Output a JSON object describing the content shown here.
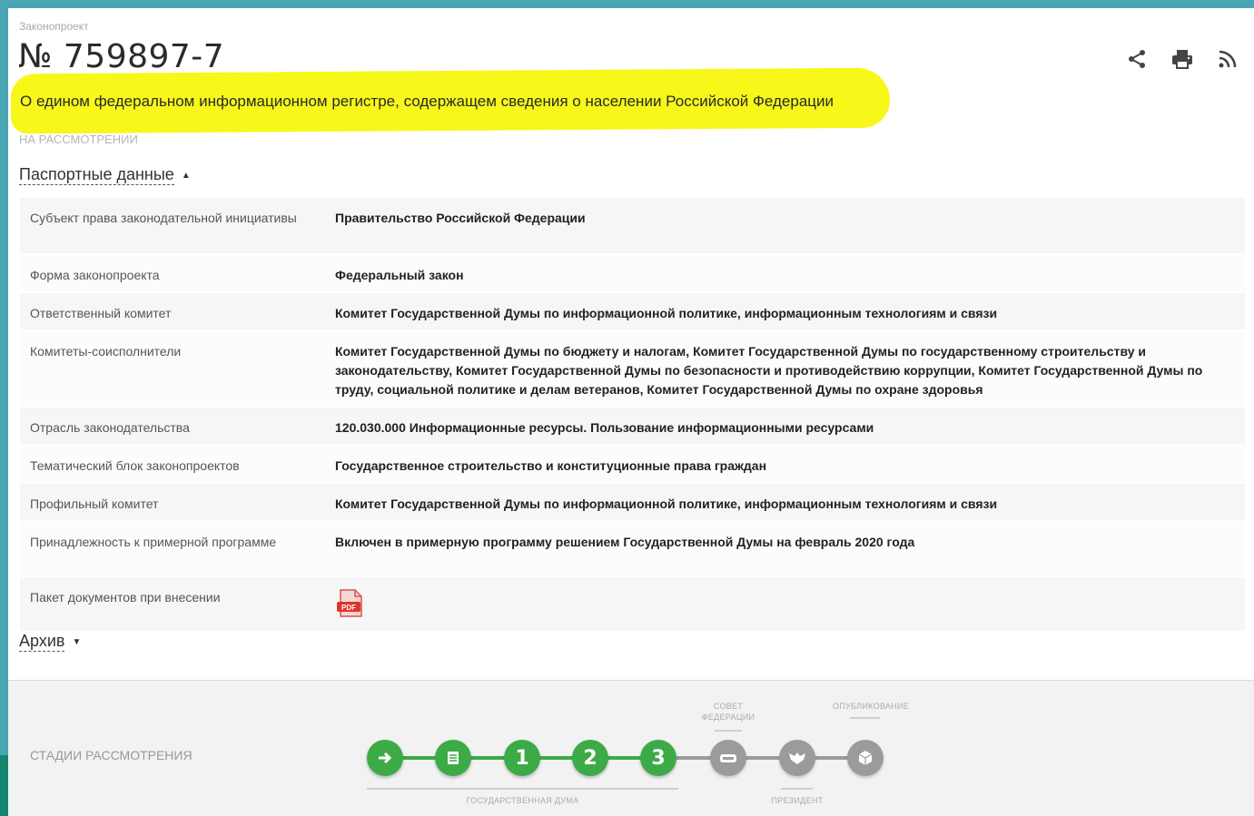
{
  "header": {
    "overline": "Законопроект",
    "number": "№ 759897-7",
    "title": "О едином федеральном информационном регистре, содержащем сведения о населении Российской Федерации",
    "status": "НА РАССМОТРЕНИИ"
  },
  "toolbar": {
    "icons": [
      "share-icon",
      "print-icon",
      "rss-icon"
    ]
  },
  "passport": {
    "toggle_label": "Паспортные данные",
    "rows": [
      {
        "key": "Субъект права законодательной инициативы",
        "value": "Правительство Российской Федерации"
      },
      {
        "key": "Форма законопроекта",
        "value": "Федеральный закон"
      },
      {
        "key": "Ответственный комитет",
        "value": "Комитет Государственной Думы по информационной политике, информационным технологиям и связи"
      },
      {
        "key": "Комитеты-соисполнители",
        "value": "Комитет Государственной Думы по бюджету и налогам, Комитет Государственной Думы по государственному строительству и законодательству, Комитет Государственной Думы по безопасности и противодействию коррупции, Комитет Государственной Думы по труду, социальной политике и делам ветеранов, Комитет Государственной Думы по охране здоровья"
      },
      {
        "key": "Отрасль законодательства",
        "value": "120.030.000 Информационные ресурсы. Пользование информационными ресурсами"
      },
      {
        "key": "Тематический блок законопроектов",
        "value": "Государственное строительство и конституционные права граждан"
      },
      {
        "key": "Профильный комитет",
        "value": "Комитет Государственной Думы по информационной политике, информационным технологиям и связи"
      },
      {
        "key": "Принадлежность к примерной программе",
        "value": "Включен в примерную программу решением Государственной Думы на февраль 2020 года"
      },
      {
        "key": "Пакет документов при внесении",
        "value": ""
      }
    ],
    "pdf_badge": "PDF"
  },
  "archive": {
    "toggle_label": "Архив"
  },
  "stages": {
    "label": "СТАДИИ РАССМОТРЕНИЯ",
    "duma_caption": "ГОСУДАРСТВЕННАЯ ДУМА",
    "council_caption_1": "СОВЕТ",
    "council_caption_2": "ФЕДЕРАЦИИ",
    "president_caption": "ПРЕЗИДЕНТ",
    "publication_caption": "ОПУБЛИКОВАНИЕ",
    "steps": [
      {
        "id": "introduction",
        "state": "done",
        "icon": "arrow-right-icon"
      },
      {
        "id": "preliminary",
        "state": "done",
        "icon": "document-icon"
      },
      {
        "id": "reading-1",
        "state": "done",
        "text": "1"
      },
      {
        "id": "reading-2",
        "state": "done",
        "text": "2"
      },
      {
        "id": "reading-3",
        "state": "done",
        "text": "3"
      },
      {
        "id": "federation-council",
        "state": "pending",
        "icon": "council-icon"
      },
      {
        "id": "president",
        "state": "pending",
        "icon": "eagle-icon"
      },
      {
        "id": "publication",
        "state": "pending",
        "icon": "publication-icon"
      }
    ]
  },
  "colors": {
    "frame": "#4aa5b5",
    "highlight": "#f7f719",
    "stage_done": "#3cab47",
    "stage_pending": "#9b9b9b"
  }
}
